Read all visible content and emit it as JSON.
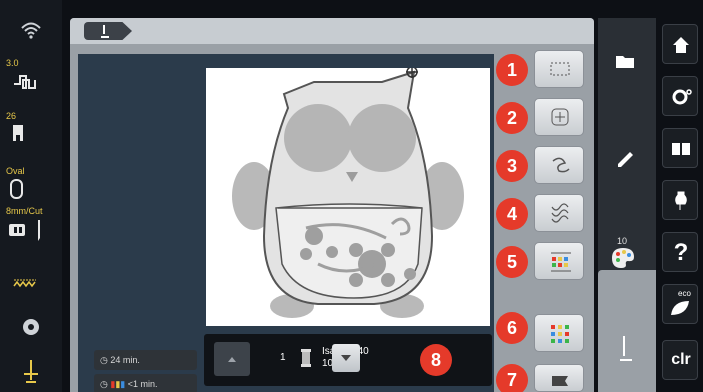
{
  "status_bar": {
    "stitch_length_value": "3.0",
    "stitch_number": "26",
    "hoop_name": "Oval",
    "hoop_size": "8mm/Cut"
  },
  "tool_badges": [
    "1",
    "2",
    "3",
    "4",
    "5",
    "6",
    "7"
  ],
  "color_count": "10",
  "bottom_info": {
    "total_time": "24 min.",
    "color_time": "<1 min.",
    "thread_index": "1",
    "thread_brand": "Isacord 40",
    "thread_code": "1032",
    "thread_badge": "8"
  },
  "right_buttons": {
    "eco_label": "eco",
    "clear_label": "clr"
  },
  "colors": {
    "badge_red": "#e53a2a",
    "panel_grey": "#9aa0a6",
    "canvas_blue": "#2b3b4b",
    "status_yellow": "#e7c84a"
  }
}
